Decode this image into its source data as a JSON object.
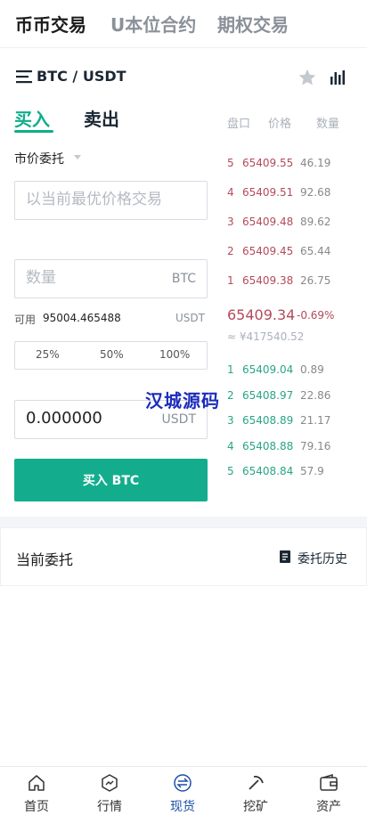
{
  "top_tabs": [
    {
      "label": "币币交易",
      "active": true
    },
    {
      "label": "U本位合约",
      "active": false
    },
    {
      "label": "期权交易",
      "active": false
    }
  ],
  "pair": {
    "name": "BTC / USDT",
    "icons": [
      "menu-lines-icon",
      "star-icon",
      "kline-chart-icon"
    ]
  },
  "trade_side": {
    "buy_label": "买入",
    "sell_label": "卖出",
    "active": "buy"
  },
  "orderbook_header": {
    "col1": "盘口",
    "col2": "价格",
    "col3": "数量"
  },
  "order_form": {
    "order_type": "市价委托",
    "price_placeholder": "以当前最优价格交易",
    "amount_placeholder": "数量",
    "amount_unit": "BTC",
    "available_label": "可用",
    "available_value": "95004.465488",
    "available_unit": "USDT",
    "percent_options": [
      "25%",
      "50%",
      "100%"
    ],
    "total_value": "0.000000",
    "total_unit": "USDT",
    "submit_label": "买入 BTC"
  },
  "asks": [
    {
      "level": "5",
      "price": "65409.55",
      "qty": "46.19"
    },
    {
      "level": "4",
      "price": "65409.51",
      "qty": "92.68"
    },
    {
      "level": "3",
      "price": "65409.48",
      "qty": "89.62"
    },
    {
      "level": "2",
      "price": "65409.45",
      "qty": "65.44"
    },
    {
      "level": "1",
      "price": "65409.38",
      "qty": "26.75"
    }
  ],
  "last_trade": {
    "price": "65409.34",
    "change": "-0.69%",
    "cny": "≈ ¥417540.52"
  },
  "bids": [
    {
      "level": "1",
      "price": "65409.04",
      "qty": "0.89"
    },
    {
      "level": "2",
      "price": "65408.97",
      "qty": "22.86"
    },
    {
      "level": "3",
      "price": "65408.89",
      "qty": "21.17"
    },
    {
      "level": "4",
      "price": "65408.88",
      "qty": "79.16"
    },
    {
      "level": "5",
      "price": "65408.84",
      "qty": "57.9"
    }
  ],
  "watermark": "汉城源码",
  "current_orders": {
    "title": "当前委托",
    "history_label": "委托历史"
  },
  "bottom_nav": [
    {
      "label": "首页",
      "icon": "home-icon",
      "active": false
    },
    {
      "label": "行情",
      "icon": "market-icon",
      "active": false
    },
    {
      "label": "现货",
      "icon": "exchange-icon",
      "active": true
    },
    {
      "label": "挖矿",
      "icon": "mining-icon",
      "active": false
    },
    {
      "label": "资产",
      "icon": "wallet-icon",
      "active": false
    }
  ],
  "colors": {
    "buy_green": "#13ad8d",
    "ask_red": "#b44a5a",
    "bid_green": "#2aa486",
    "nav_active": "#1d4fa8",
    "watermark": "#1c2dbb"
  }
}
